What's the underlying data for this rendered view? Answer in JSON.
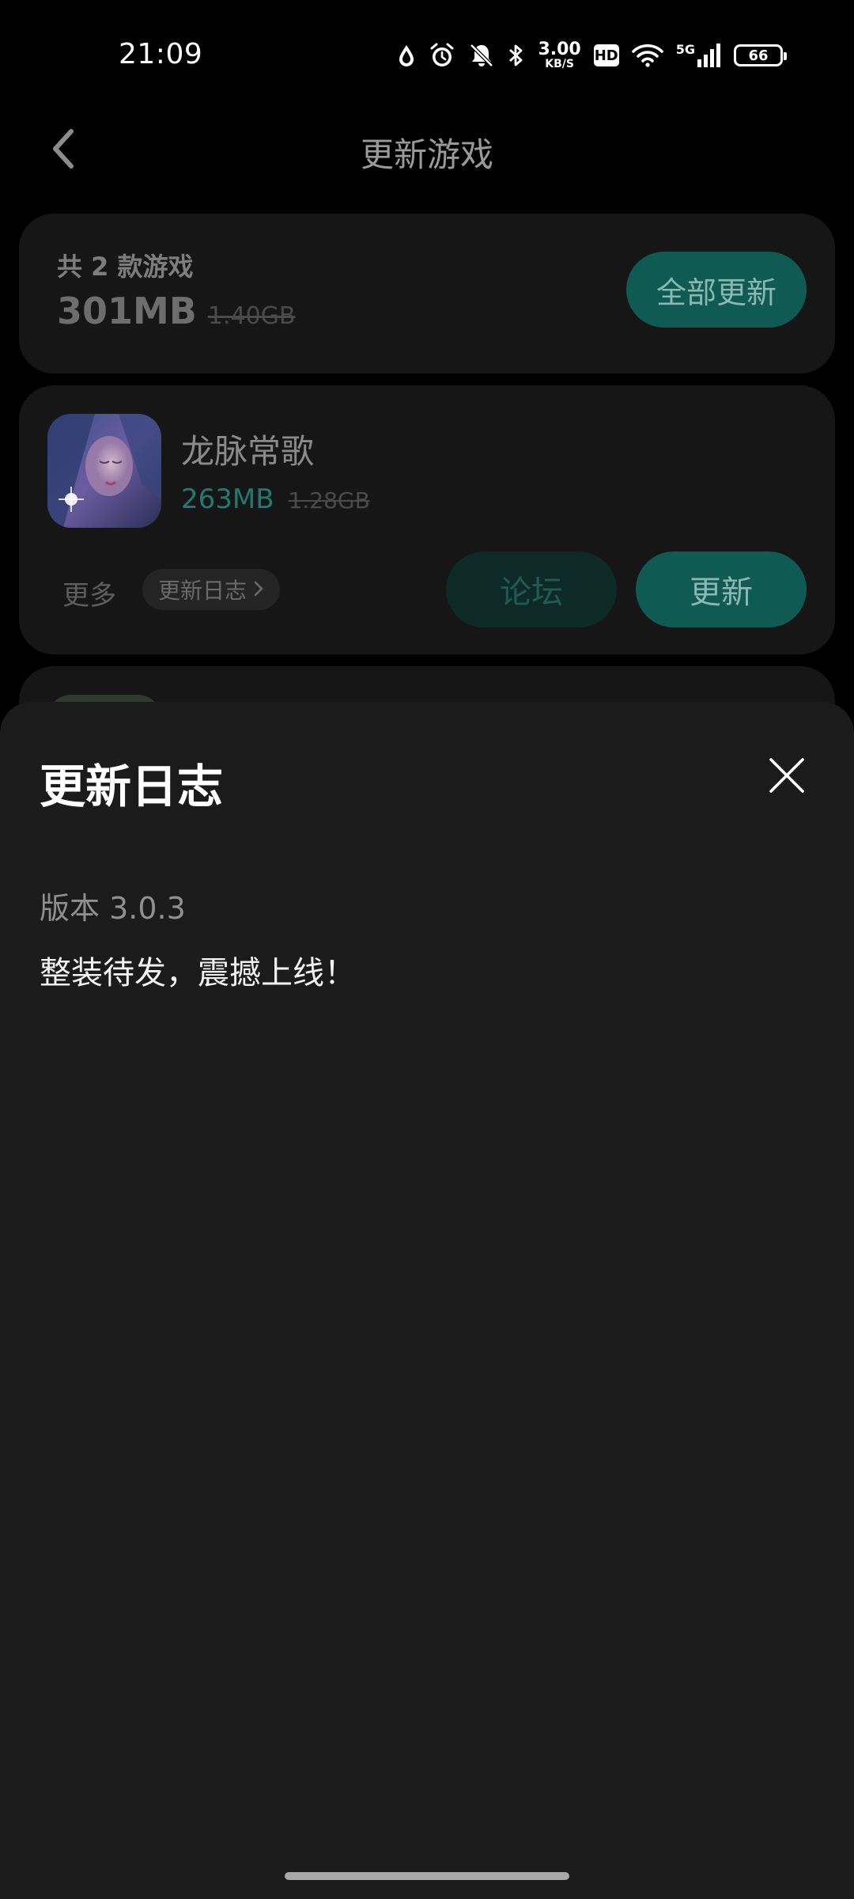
{
  "status_bar": {
    "time": "21:09",
    "speed_value": "3.00",
    "speed_unit": "KB/S",
    "hd_label": "HD",
    "network_label": "5G",
    "battery_level": "66",
    "icons": [
      "drop-icon",
      "alarm-icon",
      "mute-icon",
      "bluetooth-icon",
      "wifi-icon",
      "signal-icon"
    ]
  },
  "header": {
    "title": "更新游戏",
    "back_icon": "chevron-left-icon"
  },
  "summary": {
    "count_text": "共 2 款游戏",
    "total_size": "301MB",
    "original_size": "1.40GB",
    "update_all_label": "全部更新"
  },
  "games": [
    {
      "name": "龙脉常歌",
      "size": "263MB",
      "original_size": "1.28GB",
      "more_label": "更多",
      "changelog_label": "更新日志",
      "forum_label": "论坛",
      "update_label": "更新"
    }
  ],
  "sheet": {
    "title": "更新日志",
    "version_label": "版本 3.0.3",
    "content": "整装待发，震撼上线！"
  },
  "colors": {
    "accent": "#0f5a52",
    "accent_text": "#1f7a70",
    "sheet_bg": "#1b1b1b",
    "page_bg": "#000000"
  }
}
